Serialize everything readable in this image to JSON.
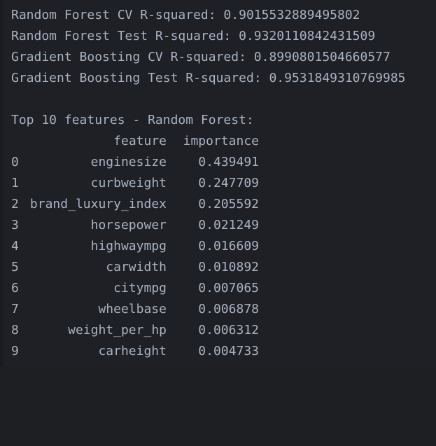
{
  "console": {
    "background_color": "#1e2025",
    "text_color": "#aab2bf",
    "metrics": [
      "Random Forest CV R-squared: 0.9015532889495802",
      "Random Forest Test R-squared: 0.9320110842431509",
      "Gradient Boosting CV R-squared: 0.8990801504660577",
      "Gradient Boosting Test R-squared: 0.9531849310769985"
    ],
    "metrics_detail": [
      {
        "label": "Random Forest CV R-squared:",
        "value": "0.9015532889495802"
      },
      {
        "label": "Random Forest Test R-squared:",
        "value": "0.9320110842431509"
      },
      {
        "label": "Gradient Boosting CV R-squared:",
        "value": "0.8990801504660577"
      },
      {
        "label": "Gradient Boosting Test R-squared:",
        "value": "0.9531849310769985"
      }
    ],
    "table_title": "Top 10 features - Random Forest:",
    "table": {
      "columns": [
        "feature",
        "importance"
      ],
      "header_index": "",
      "rows": [
        {
          "index": "0",
          "feature": "enginesize",
          "importance": "0.439491"
        },
        {
          "index": "1",
          "feature": "curbweight",
          "importance": "0.247709"
        },
        {
          "index": "2",
          "feature": "brand_luxury_index",
          "importance": "0.205592"
        },
        {
          "index": "3",
          "feature": "horsepower",
          "importance": "0.021249"
        },
        {
          "index": "4",
          "feature": "highwaympg",
          "importance": "0.016609"
        },
        {
          "index": "5",
          "feature": "carwidth",
          "importance": "0.010892"
        },
        {
          "index": "6",
          "feature": "citympg",
          "importance": "0.007065"
        },
        {
          "index": "7",
          "feature": "wheelbase",
          "importance": "0.006878"
        },
        {
          "index": "8",
          "feature": "weight_per_hp",
          "importance": "0.006312"
        },
        {
          "index": "9",
          "feature": "carheight",
          "importance": "0.004733"
        }
      ]
    }
  }
}
